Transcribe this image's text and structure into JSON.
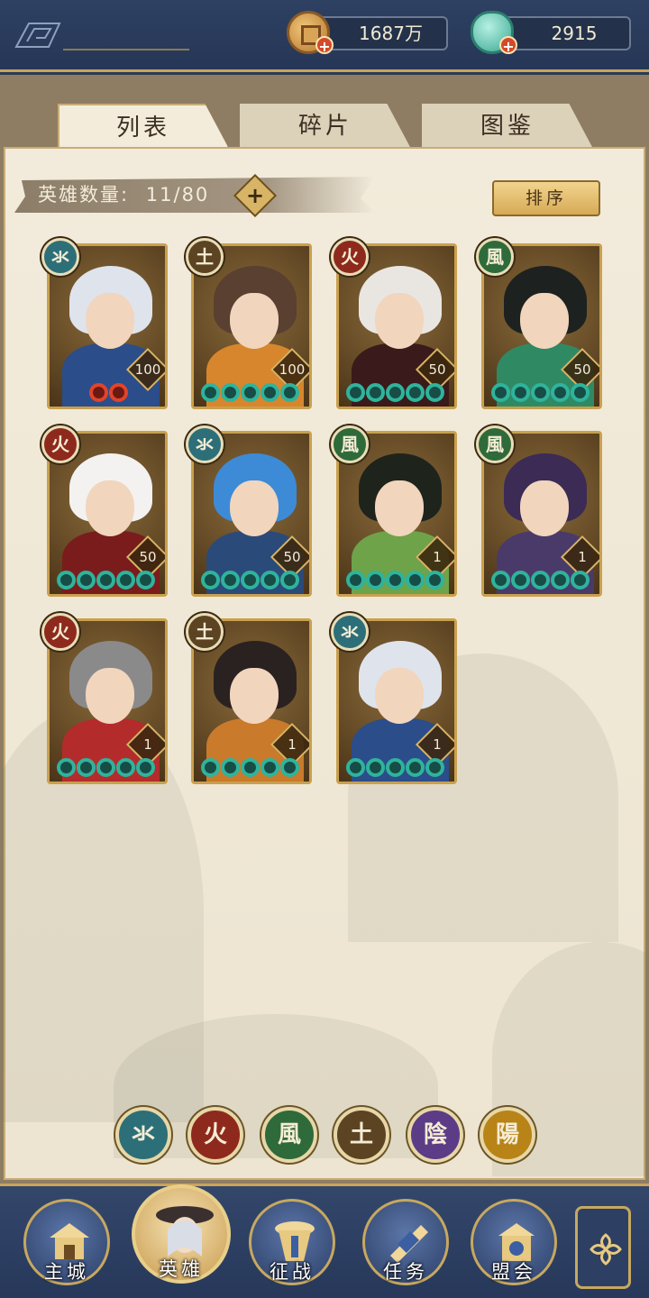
{
  "resources": {
    "coins": "1687万",
    "jade": "2915"
  },
  "tabs": [
    "列表",
    "碎片",
    "图鉴"
  ],
  "hero_count": {
    "label": "英雄数量:",
    "value": "11/80"
  },
  "sort_label": "排序",
  "elements": {
    "water": {
      "glyph": "氺",
      "color": "#2d6f78"
    },
    "fire": {
      "glyph": "火",
      "color": "#8e2a1d"
    },
    "wind": {
      "glyph": "風",
      "color": "#2f6a3a"
    },
    "earth": {
      "glyph": "土",
      "color": "#5c4422"
    },
    "yin": {
      "glyph": "陰",
      "color": "#5c3c86"
    },
    "yang": {
      "glyph": "陽",
      "color": "#b88418"
    }
  },
  "heroes": [
    {
      "element": "water",
      "level": "100",
      "stars": "red2",
      "hair": "#dfe3ec",
      "body": "#2b4d8a"
    },
    {
      "element": "earth",
      "level": "100",
      "stars": "teal5",
      "hair": "#5a4030",
      "body": "#d8862d"
    },
    {
      "element": "fire",
      "level": "50",
      "stars": "teal5",
      "hair": "#e9e6e2",
      "body": "#3a1a1a"
    },
    {
      "element": "wind",
      "level": "50",
      "stars": "teal5",
      "hair": "#1d2220",
      "body": "#2f8a64"
    },
    {
      "element": "fire",
      "level": "50",
      "stars": "teal5",
      "hair": "#f3f2f0",
      "body": "#7a1c1c"
    },
    {
      "element": "water",
      "level": "50",
      "stars": "teal5",
      "hair": "#3d8bd6",
      "body": "#2a4a7a"
    },
    {
      "element": "wind",
      "level": "1",
      "stars": "teal5",
      "hair": "#1e241c",
      "body": "#6ea34a"
    },
    {
      "element": "wind",
      "level": "1",
      "stars": "teal5",
      "hair": "#3b2b55",
      "body": "#4a3a6a"
    },
    {
      "element": "fire",
      "level": "1",
      "stars": "teal5",
      "hair": "#8a8a8a",
      "body": "#b42b2b"
    },
    {
      "element": "earth",
      "level": "1",
      "stars": "teal5",
      "hair": "#2a2220",
      "body": "#c97a2a"
    },
    {
      "element": "water",
      "level": "1",
      "stars": "teal5",
      "hair": "#dfe3ec",
      "body": "#2b4d8a"
    }
  ],
  "filters": [
    "water",
    "fire",
    "wind",
    "earth",
    "yin",
    "yang"
  ],
  "nav": [
    {
      "label": "主城",
      "icon": "city-icon"
    },
    {
      "label": "英雄",
      "icon": "hero-icon"
    },
    {
      "label": "征战",
      "icon": "battle-icon"
    },
    {
      "label": "任务",
      "icon": "quest-icon"
    },
    {
      "label": "盟会",
      "icon": "guild-icon"
    }
  ]
}
